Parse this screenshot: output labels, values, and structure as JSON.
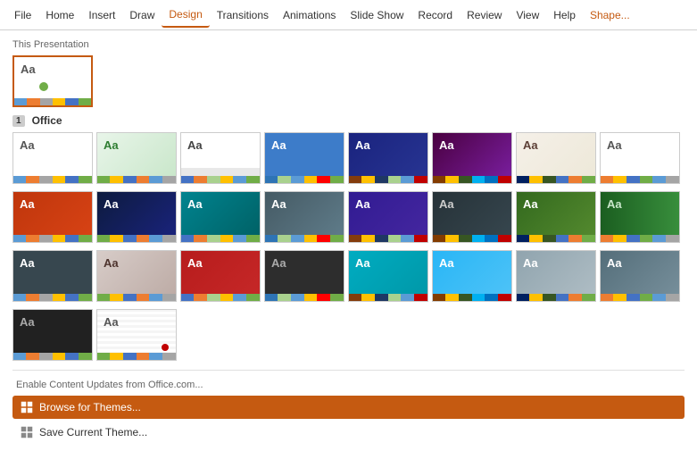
{
  "menubar": {
    "items": [
      {
        "id": "file",
        "label": "File",
        "active": false
      },
      {
        "id": "home",
        "label": "Home",
        "active": false
      },
      {
        "id": "insert",
        "label": "Insert",
        "active": false
      },
      {
        "id": "draw",
        "label": "Draw",
        "active": false
      },
      {
        "id": "design",
        "label": "Design",
        "active": true
      },
      {
        "id": "transitions",
        "label": "Transitions",
        "active": false
      },
      {
        "id": "animations",
        "label": "Animations",
        "active": false
      },
      {
        "id": "slideshow",
        "label": "Slide Show",
        "active": false
      },
      {
        "id": "record",
        "label": "Record",
        "active": false
      },
      {
        "id": "review",
        "label": "Review",
        "active": false
      },
      {
        "id": "view",
        "label": "View",
        "active": false
      },
      {
        "id": "help",
        "label": "Help",
        "active": false
      },
      {
        "id": "shape",
        "label": "Shape...",
        "active": false,
        "red": true
      }
    ]
  },
  "panel": {
    "this_presentation_label": "This Presentation",
    "office_label": "Office",
    "slide_number": "1",
    "footer": {
      "enable_text": "Enable Content Updates from Office.com...",
      "browse_label": "Browse for Themes...",
      "save_label": "Save Current Theme..."
    }
  },
  "themes": {
    "current": [
      {
        "id": "blank",
        "style": "t-blank",
        "bar": "color-bar-1"
      }
    ],
    "office": [
      {
        "id": "t1",
        "style": "t-blank",
        "bar": "color-bar-1"
      },
      {
        "id": "t2",
        "style": "t-green",
        "bar": "color-bar-2"
      },
      {
        "id": "t3",
        "style": "t-lined",
        "bar": "color-bar-3"
      },
      {
        "id": "t4",
        "style": "t-blue-geo",
        "bar": "color-bar-4"
      },
      {
        "id": "t5",
        "style": "t-dark-blue",
        "bar": "color-bar-5"
      },
      {
        "id": "t6",
        "style": "t-dark-magenta",
        "bar": "color-bar-6"
      },
      {
        "id": "t7",
        "style": "t-beige",
        "bar": "color-bar-7"
      },
      {
        "id": "t8",
        "style": "t-plain",
        "bar": "color-bar-8"
      },
      {
        "id": "t9",
        "style": "t-orange",
        "bar": "color-bar-1"
      },
      {
        "id": "t10",
        "style": "t-dark-navy",
        "bar": "color-bar-2"
      },
      {
        "id": "t11",
        "style": "t-teal",
        "bar": "color-bar-3"
      },
      {
        "id": "t12",
        "style": "t-gray-fade",
        "bar": "color-bar-4"
      },
      {
        "id": "t13",
        "style": "t-purple",
        "bar": "color-bar-5"
      },
      {
        "id": "t14",
        "style": "t-dark-gray",
        "bar": "color-bar-6"
      },
      {
        "id": "t15",
        "style": "t-green-arrow",
        "bar": "color-bar-7"
      },
      {
        "id": "t16",
        "style": "t-charcoal",
        "bar": "color-bar-8"
      },
      {
        "id": "t17",
        "style": "t-tan",
        "bar": "color-bar-1"
      },
      {
        "id": "t18",
        "style": "t-red-stripe",
        "bar": "color-bar-2"
      },
      {
        "id": "t19",
        "style": "t-dark2",
        "bar": "color-bar-3"
      },
      {
        "id": "t20",
        "style": "t-cyan",
        "bar": "color-bar-4"
      },
      {
        "id": "t21",
        "style": "t-blue-geo2",
        "bar": "color-bar-5"
      },
      {
        "id": "t22",
        "style": "t-dark3",
        "bar": "color-bar-6"
      },
      {
        "id": "t23",
        "style": "t-silver",
        "bar": "color-bar-7"
      },
      {
        "id": "t24",
        "style": "t-slate",
        "bar": "color-bar-8"
      },
      {
        "id": "t25",
        "style": "t-dark4",
        "bar": "color-bar-1"
      },
      {
        "id": "t26",
        "style": "t-lines2",
        "bar": "color-bar-2"
      },
      {
        "id": "t27",
        "style": "t-dots",
        "bar": "color-bar-3"
      }
    ]
  }
}
